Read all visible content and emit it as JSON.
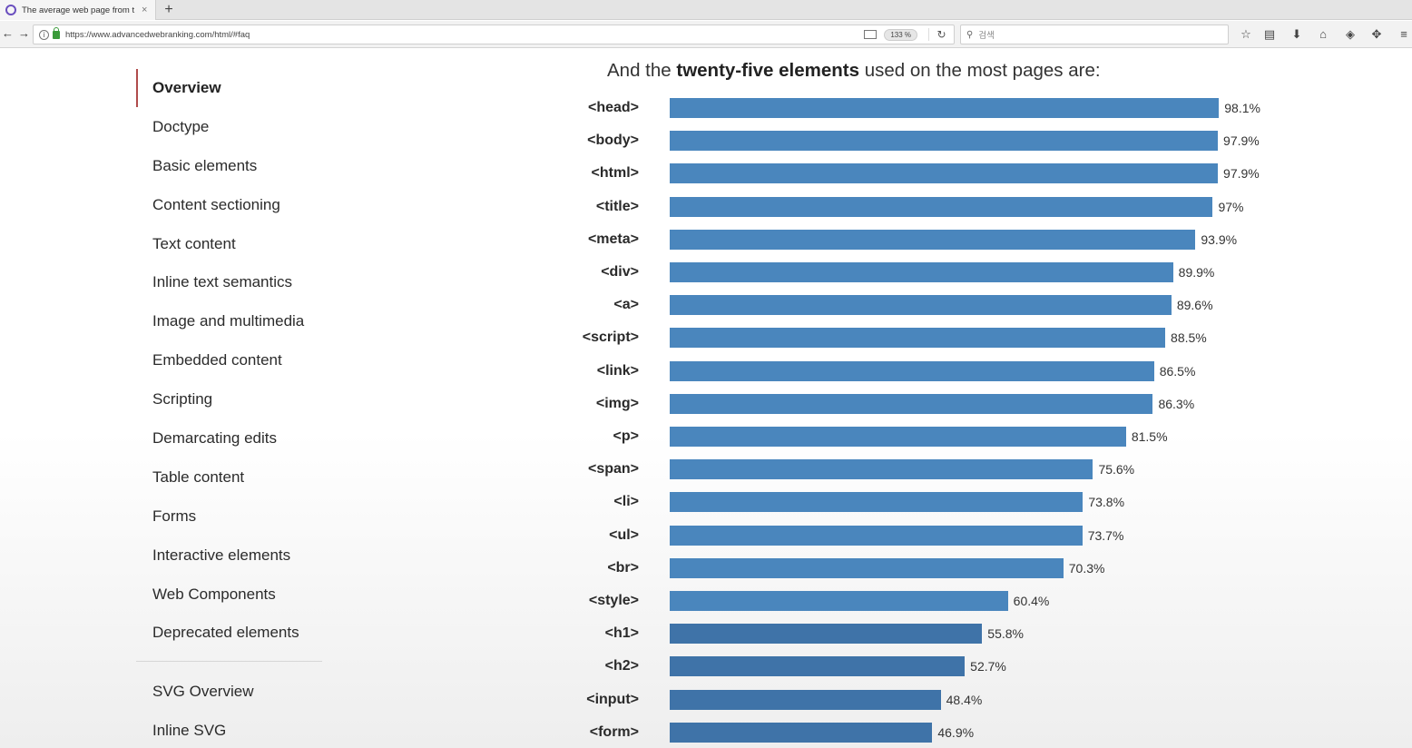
{
  "browser": {
    "tab_title": "The average web page from t",
    "tab_close": "×",
    "new_tab": "+",
    "back": "←",
    "forward": "→",
    "url": "https://www.advancedwebranking.com/html/#faq",
    "zoom": "133 %",
    "search_placeholder": "검색"
  },
  "sidebar": {
    "items": [
      {
        "label": "Overview",
        "active": true
      },
      {
        "label": "Doctype"
      },
      {
        "label": "Basic elements"
      },
      {
        "label": "Content sectioning"
      },
      {
        "label": "Text content"
      },
      {
        "label": "Inline text semantics"
      },
      {
        "label": "Image and multimedia"
      },
      {
        "label": "Embedded content"
      },
      {
        "label": "Scripting"
      },
      {
        "label": "Demarcating edits"
      },
      {
        "label": "Table content"
      },
      {
        "label": "Forms"
      },
      {
        "label": "Interactive elements"
      },
      {
        "label": "Web Components"
      },
      {
        "label": "Deprecated elements"
      }
    ],
    "svg_items": [
      {
        "label": "SVG Overview"
      },
      {
        "label": "Inline SVG"
      }
    ]
  },
  "heading": {
    "prefix": "And the ",
    "bold": "twenty-five elements",
    "suffix": " used on the most pages are:"
  },
  "colors": {
    "bar": "#4a86bd",
    "bar_dark": "#3f73a8",
    "active_marker": "#b04b4b"
  },
  "chart_data": {
    "type": "bar",
    "orientation": "horizontal",
    "categories": [
      "<head>",
      "<body>",
      "<html>",
      "<title>",
      "<meta>",
      "<div>",
      "<a>",
      "<script>",
      "<link>",
      "<img>",
      "<p>",
      "<span>",
      "<li>",
      "<ul>",
      "<br>",
      "<style>",
      "<h1>",
      "<h2>",
      "<input>",
      "<form>"
    ],
    "values": [
      98.1,
      97.9,
      97.9,
      97,
      93.9,
      89.9,
      89.6,
      88.5,
      86.5,
      86.3,
      81.5,
      75.6,
      73.8,
      73.7,
      70.3,
      60.4,
      55.8,
      52.7,
      48.4,
      46.9
    ],
    "value_labels": [
      "98.1%",
      "97.9%",
      "97.9%",
      "97%",
      "93.9%",
      "89.9%",
      "89.6%",
      "88.5%",
      "86.5%",
      "86.3%",
      "81.5%",
      "75.6%",
      "73.8%",
      "73.7%",
      "70.3%",
      "60.4%",
      "55.8%",
      "52.7%",
      "48.4%",
      "46.9%"
    ],
    "xlim": [
      0,
      100
    ]
  }
}
